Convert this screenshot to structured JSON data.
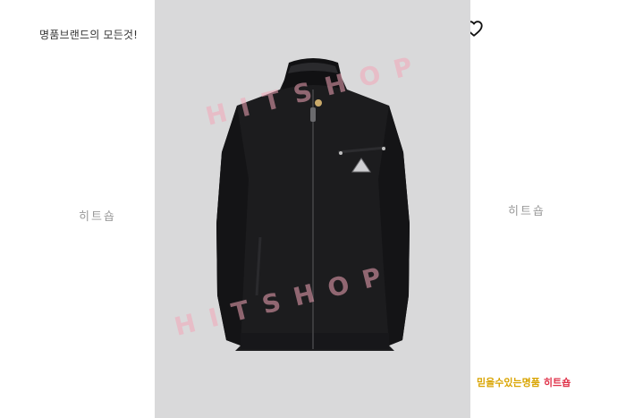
{
  "header": {
    "tagline": "명품브랜드의 모든것!"
  },
  "actions": {
    "favorite_icon": "heart-outline-icon"
  },
  "watermarks": {
    "side_left": "히트숍",
    "side_right": "히트숍",
    "overlay_top": "HITSHOP",
    "overlay_bottom": "HITSHOP",
    "footer_part1": "믿을수있는명품",
    "footer_part2": "히트숍"
  },
  "colors": {
    "photo_bg": "#d9d9da",
    "jacket": "#1c1c1e",
    "watermark_overlay": "#f2a6b8",
    "footer_gold": "#d9a400",
    "footer_red": "#e0334a"
  }
}
